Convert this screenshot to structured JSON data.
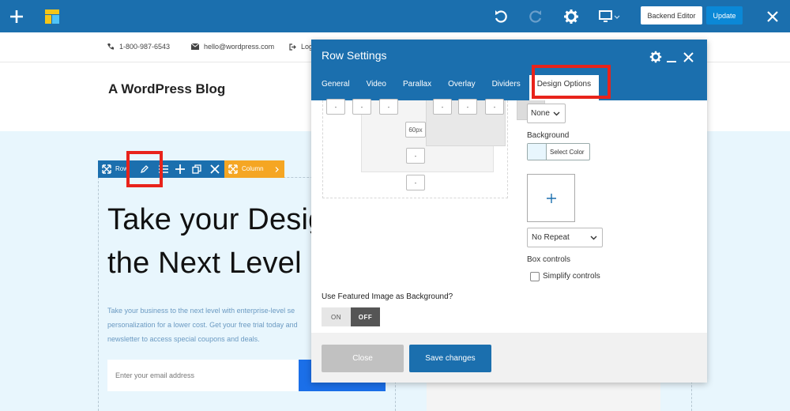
{
  "toolbar": {
    "backend_editor_label": "Backend Editor",
    "update_label": "Update",
    "icons": [
      "plus-icon",
      "layout-icon",
      "undo-icon",
      "redo-icon",
      "gear-icon",
      "desktop-icon",
      "close-icon"
    ],
    "colors": {
      "bar": "#1b6fae",
      "update": "#0b88d6"
    }
  },
  "site": {
    "phone": "1-800-987-6543",
    "email": "hello@wordpress.com",
    "login_partial": "Log",
    "title": "A WordPress Blog"
  },
  "row_toolbar": {
    "row_label": "Row",
    "column_label": "Column",
    "colors": {
      "row": "#1b6fae",
      "column": "#f5a623",
      "highlight": "#e8231b"
    }
  },
  "hero": {
    "line1": "Take your Desig",
    "line2": "the Next Level",
    "paragraph_lines": [
      "Take your business to the next level with enterprise-level se",
      "personalization for a lower cost. Get your free trial today and",
      "newsletter to access special coupons and deals."
    ],
    "email_placeholder": "Enter your email address"
  },
  "modal": {
    "title": "Row Settings",
    "tabs": [
      "General",
      "Video",
      "Parallax",
      "Overlay",
      "Dividers",
      "Design Options"
    ],
    "active_tab": "Design Options",
    "spacing": {
      "top_row_fields": [
        "-",
        "-",
        "-",
        "-",
        "-",
        "-"
      ],
      "padding_value": "60px",
      "border_bottom": "-",
      "margin_bottom": "-"
    },
    "border_style_value": "None",
    "background_label": "Background",
    "select_color_label": "Select Color",
    "add_image_symbol": "+",
    "repeat_value": "No Repeat",
    "box_controls_label": "Box controls",
    "simplify_controls_label": "Simplify controls",
    "featured_image_label": "Use Featured Image as Background?",
    "toggle_on": "ON",
    "toggle_off": "OFF",
    "close_label": "Close",
    "save_label": "Save changes"
  }
}
